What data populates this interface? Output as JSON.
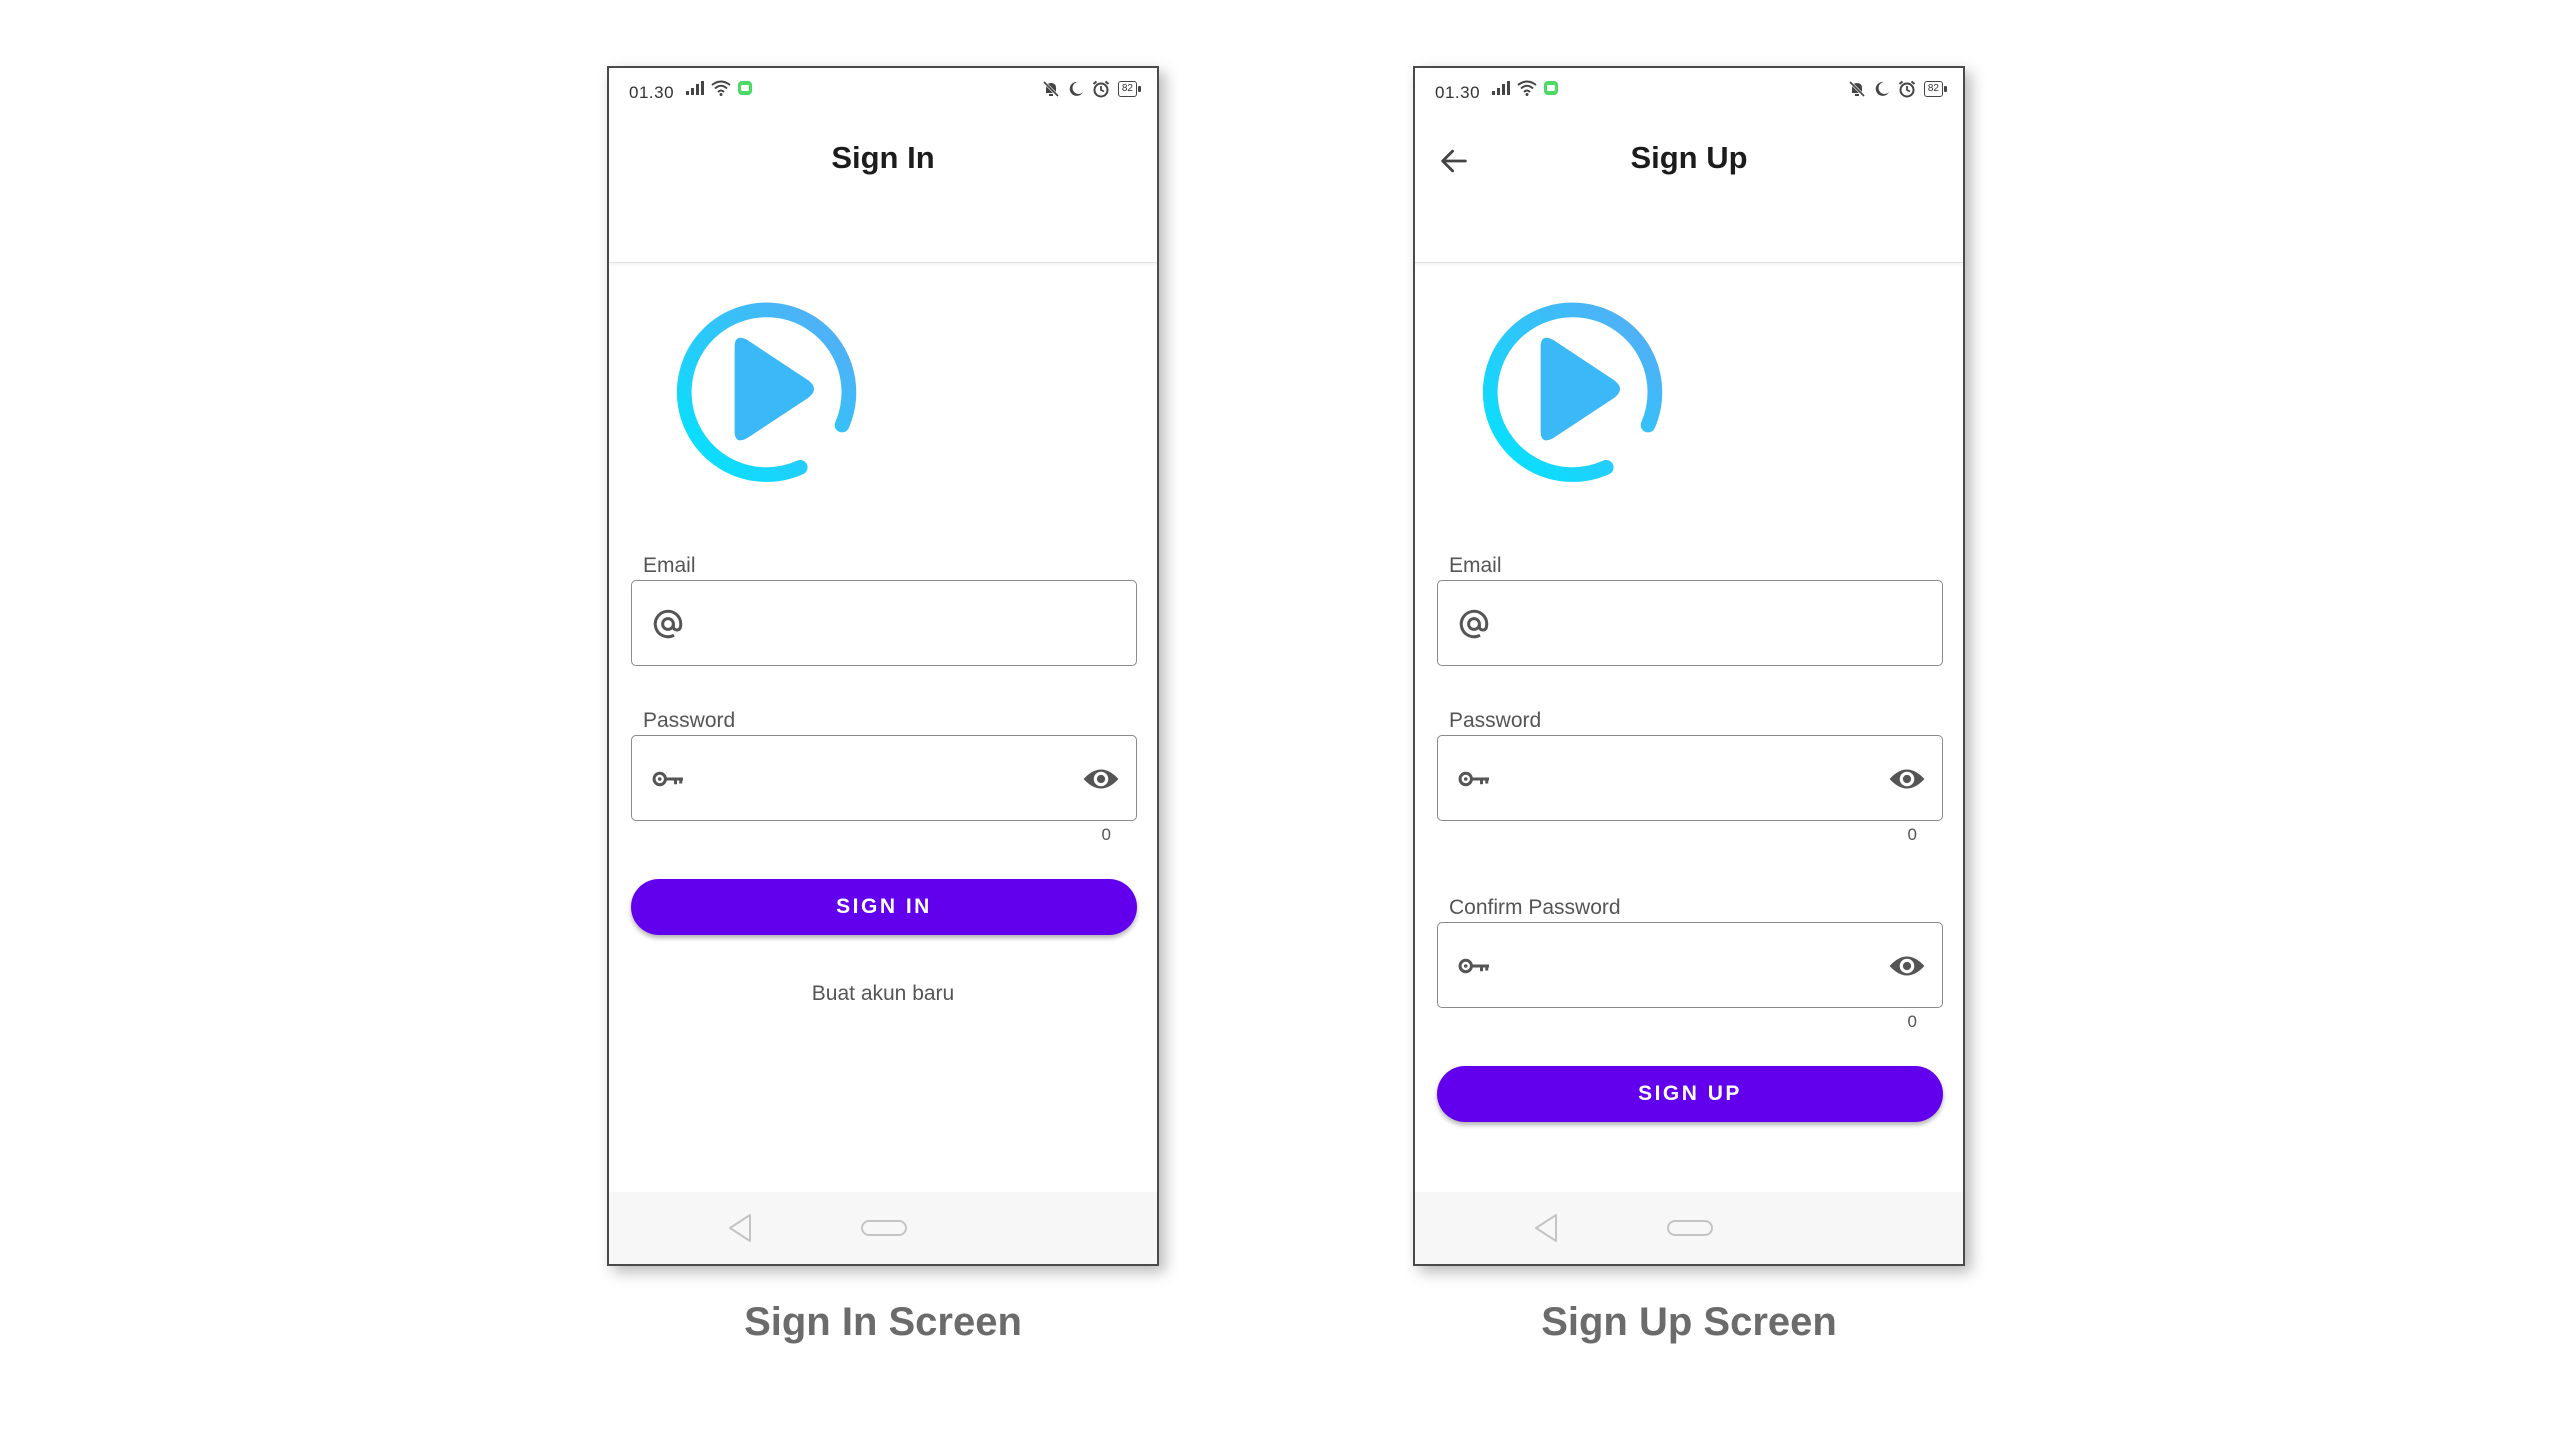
{
  "signin": {
    "status": {
      "time": "01.30",
      "battery": "82"
    },
    "title": "Sign In",
    "email_label": "Email",
    "email_value": "",
    "password_label": "Password",
    "password_value": "",
    "password_counter": "0",
    "button_label": "SIGN IN",
    "link_label": "Buat akun baru",
    "caption": "Sign In Screen"
  },
  "signup": {
    "status": {
      "time": "01.30",
      "battery": "82"
    },
    "title": "Sign Up",
    "email_label": "Email",
    "email_value": "",
    "password_label": "Password",
    "password_value": "",
    "password_counter": "0",
    "confirm_label": "Confirm Password",
    "confirm_value": "",
    "confirm_counter": "0",
    "button_label": "SIGN UP",
    "caption": "Sign Up Screen"
  },
  "colors": {
    "primary": "#6200ee",
    "logo_gradient_start": "#00e5ff",
    "logo_gradient_end": "#5aa9f5",
    "play_fill": "#3ab8f7"
  },
  "icons": [
    "at-icon",
    "key-icon",
    "eye-icon",
    "back-arrow-icon",
    "signal-icon",
    "wifi-icon",
    "mute-icon",
    "moon-icon",
    "alarm-icon",
    "battery-icon"
  ]
}
